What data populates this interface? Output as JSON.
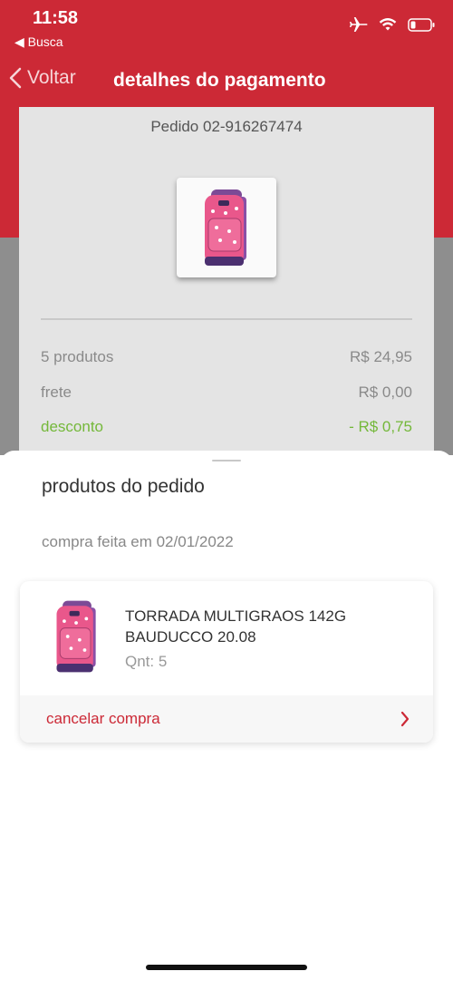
{
  "status_bar": {
    "time": "11:58",
    "back_app": "◀ Busca",
    "icons": [
      "airplane-icon",
      "wifi-icon",
      "battery-icon"
    ]
  },
  "nav": {
    "back_label": "Voltar",
    "title": "detalhes do pagamento"
  },
  "order": {
    "number": "Pedido 02-916267474",
    "summary": [
      {
        "label": "5 produtos",
        "value": "R$ 24,95"
      },
      {
        "label": "frete",
        "value": "R$ 0,00"
      },
      {
        "label": "desconto",
        "value": "- R$ 0,75"
      }
    ]
  },
  "sheet": {
    "title": "produtos do pedido",
    "purchase_date": "compra feita em 02/01/2022",
    "product": {
      "name": "TORRADA MULTIGRAOS 142G BAUDUCCO 20.08",
      "quantity": "Qnt: 5"
    },
    "cancel_label": "cancelar compra"
  },
  "colors": {
    "brand_red": "#cc2936",
    "discount_green": "#74b83a"
  }
}
